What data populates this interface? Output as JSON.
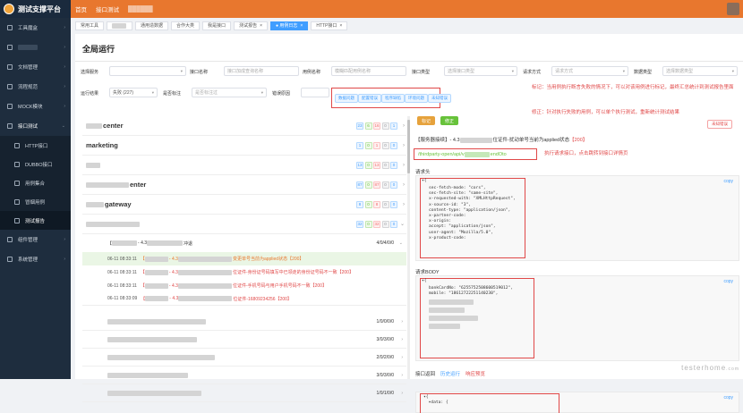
{
  "app": {
    "logo_text": "测试支撑平台"
  },
  "topnav": {
    "items": [
      "首页",
      "接口测试"
    ]
  },
  "sidebar": {
    "items": [
      {
        "label": "工具魔盒",
        "icon": "toolbox-icon"
      },
      {
        "label": "",
        "icon": "folder-icon"
      },
      {
        "label": "文档管理",
        "icon": "document-icon"
      },
      {
        "label": "流程规范",
        "icon": "flow-icon"
      },
      {
        "label": "MOCK模块",
        "icon": "mock-icon"
      },
      {
        "label": "接口测试",
        "icon": "api-icon"
      }
    ],
    "sub_items": [
      {
        "label": "HTTP接口",
        "icon": "http-icon"
      },
      {
        "label": "DUBBO接口",
        "icon": "dubbo-icon"
      },
      {
        "label": "用例集合",
        "icon": "case-icon"
      },
      {
        "label": "冒烟用例",
        "icon": "smoke-icon"
      },
      {
        "label": "测试报告",
        "icon": "report-icon"
      }
    ],
    "bottom_items": [
      {
        "label": "组件管理",
        "icon": "component-icon"
      },
      {
        "label": "系统管理",
        "icon": "settings-icon"
      }
    ]
  },
  "tabs": [
    "常用工具",
    "",
    "通用造数据",
    "合作大类",
    "我是接口",
    "测试报告",
    "● 用例日志",
    "HTTP接口"
  ],
  "page": {
    "title": "全局运行"
  },
  "filters": {
    "service_label": "选择服务",
    "api_name_label": "接口名称",
    "api_name_placeholder": "接口加成查询名称",
    "case_name_label": "用例名称",
    "case_name_placeholder": "模糊匹配用例名称",
    "api_type_label": "接口类型",
    "api_type_placeholder": "选择接口类型",
    "req_method_label": "请求方式",
    "req_method_placeholder": "请求方式",
    "data_type_label": "数据类型",
    "data_type_placeholder": "选择数据类型",
    "result_label": "运行结果",
    "result_value": "失败 (227)",
    "mark_label": "是否标注",
    "mark_placeholder": "是否标注过",
    "error_type_label": "错误原因"
  },
  "quick_buttons": [
    "数据问题",
    "配置错误",
    "程序缺陷",
    "环境问题",
    "未知错误"
  ],
  "annotations": {
    "mark_note": "标记：当用例执行断言失败的情况下，可以对该用例进行标记，最终汇总统计到测试报告里面",
    "fix_note": "修正：针对执行失败的用例，可以单个执行测试，重新统计测试结果",
    "fix_button": "未知错误",
    "exec_note": "执行请求接口，点击跳转到接口详情页"
  },
  "groups": [
    {
      "name": "center",
      "counts": [
        "23",
        "6",
        "16",
        "0",
        "1"
      ]
    },
    {
      "name": "marketing",
      "counts": [
        "1",
        "0",
        "1",
        "0",
        "0"
      ]
    },
    {
      "name": "",
      "counts": [
        "13",
        "0",
        "13",
        "0",
        "0"
      ]
    },
    {
      "name": "enter",
      "counts": [
        "87",
        "0",
        "87",
        "0",
        "0"
      ]
    },
    {
      "name": "gateway",
      "counts": [
        "8",
        "0",
        "8",
        "0",
        "0"
      ]
    },
    {
      "name": "",
      "counts": [
        "32",
        "0",
        "32",
        "0",
        "0"
      ]
    }
  ],
  "expanded": {
    "head_prefix": "【",
    "head_mid": "- 4.3",
    "head_suffix": "冲退",
    "head_count": "4/0/4/0/0",
    "cases": [
      {
        "time": "06-11 08:33:11",
        "prefix": "【",
        "mid": "- 4.3",
        "msg": "变更单号当前为applied状态【200】",
        "sel": true
      },
      {
        "time": "06-11 08:33:11",
        "prefix": "【",
        "mid": "- 4.3",
        "msg": "位证件-身份证号码填写中已领走的身份证号码不一致【200】",
        "sel": false
      },
      {
        "time": "06-11 08:33:11",
        "prefix": "【",
        "mid": "- 4.3",
        "msg": "位证件-手机号码与用户手机号码不一致【200】",
        "sel": false
      },
      {
        "time": "06-11 08:33:09",
        "prefix": "【",
        "mid": "- 4.3",
        "msg": "位证件-16809234256【200】",
        "sel": false
      }
    ]
  },
  "small_rows": [
    "1/0/0/0/0",
    "3/0/3/0/0",
    "2/0/2/0/0",
    "3/0/3/0/0",
    "1/0/1/0/0"
  ],
  "detail": {
    "btn_mark": "标记",
    "btn_fix": "修正",
    "title_prefix": "【服务器接续】- 4.3",
    "title_mid": "位证件-扰动单号当前为applied状态",
    "title_res": "【200】",
    "url_prefix": "/thirdparty-open/api/v",
    "url_suffix": "endOto",
    "headers_label": "请求头",
    "headers_lines": [
      "sec-fetch-mode: \"cors\",",
      "sec-fetch-site: \"same-site\",",
      "x-requested-with: \"XMLHttpRequest\",",
      "x-source-id: \"3\",",
      "content-type: \"application/json\",",
      "x-partner-code:",
      "x-origin:",
      "accept: \"application/json\",",
      "user-agent: \"Mozilla/5.0\",",
      "x-product-code:"
    ],
    "copy": "copy",
    "body_label": "请求BODY",
    "body_lines": [
      "bankCardNo: \"6255752508600519012\",",
      "mobile: \"18612722251140230\","
    ],
    "resp_tabs": [
      "接口返回",
      "历史运行",
      "响应预览"
    ],
    "resp_lines": [
      "▾{",
      "  ▾data: {"
    ]
  },
  "watermark": {
    "main": "testerhome",
    "sub": ".com"
  }
}
